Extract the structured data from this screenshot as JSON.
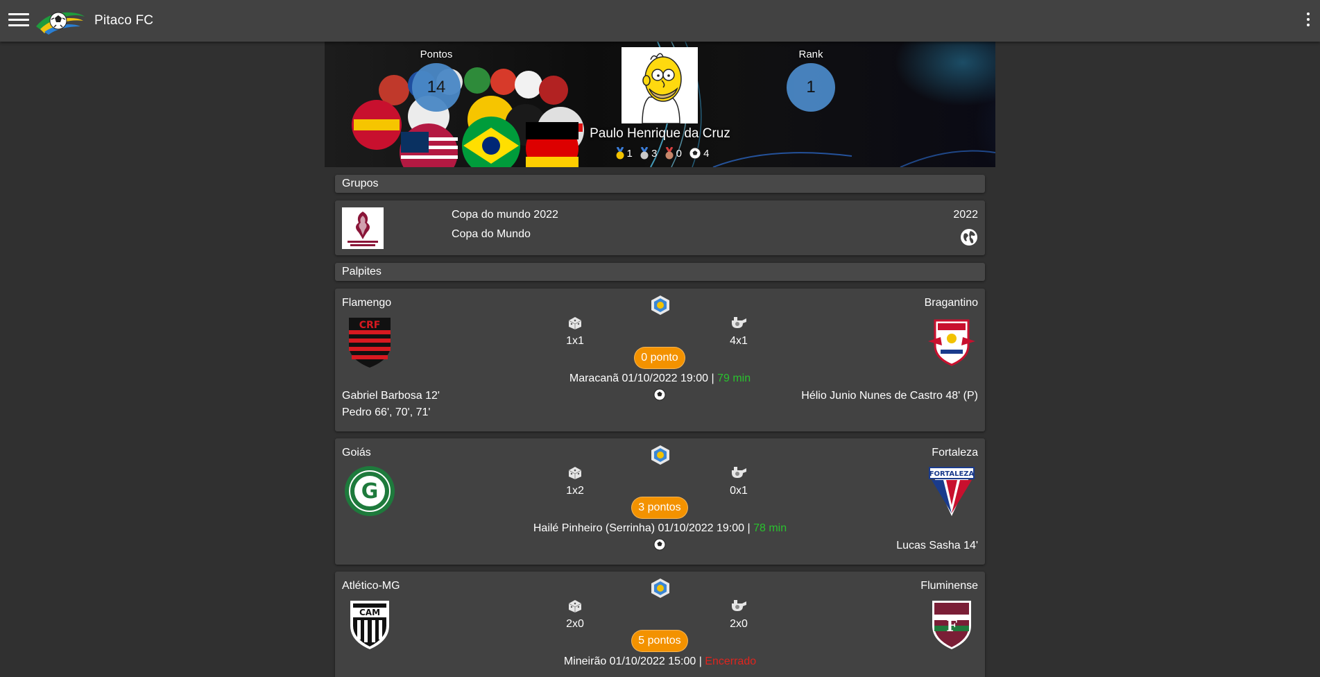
{
  "app": {
    "title": "Pitaco FC"
  },
  "profile": {
    "points_label": "Pontos",
    "points_value": "14",
    "rank_label": "Rank",
    "rank_value": "1",
    "name": "Paulo Henrique da Cruz",
    "medals": {
      "gold": "1",
      "silver": "3",
      "bronze": "0",
      "balls": "4"
    }
  },
  "sections": {
    "groups": "Grupos",
    "guesses": "Palpites"
  },
  "group": {
    "name": "Copa do mundo 2022",
    "competition": "Copa do Mundo",
    "year": "2022",
    "thumb_icon": "world-cup-logo"
  },
  "matches": [
    {
      "home": "Flamengo",
      "away": "Bragantino",
      "guess_a": "1x1",
      "guess_b": "4x1",
      "points": "0 ponto",
      "venue": "Maracanã 01/10/2022 19:00",
      "status": "79 min",
      "home_scorers": [
        "Gabriel Barbosa 12'",
        "Pedro 66', 70', 71'"
      ],
      "away_scorers": [
        "Hélio Junio Nunes de Castro 48' (P)"
      ]
    },
    {
      "home": "Goiás",
      "away": "Fortaleza",
      "guess_a": "1x2",
      "guess_b": "0x1",
      "points": "3 pontos",
      "venue": "Hailé Pinheiro (Serrinha) 01/10/2022 19:00",
      "status": "78 min",
      "home_scorers": [],
      "away_scorers": [
        "Lucas Sasha 14'"
      ]
    },
    {
      "home": "Atlético-MG",
      "away": "Fluminense",
      "guess_a": "2x0",
      "guess_b": "2x0",
      "points": "5 pontos",
      "venue": "Mineirão 01/10/2022 15:00",
      "status": "Encerrado"
    }
  ],
  "colors": {
    "appbar": "#424242",
    "background": "#303030",
    "card": "#424242",
    "accent_orange": "#f39200",
    "live_green": "#29c22e",
    "ended_red": "#e0241e",
    "stat_circle": "#4a88c6"
  }
}
